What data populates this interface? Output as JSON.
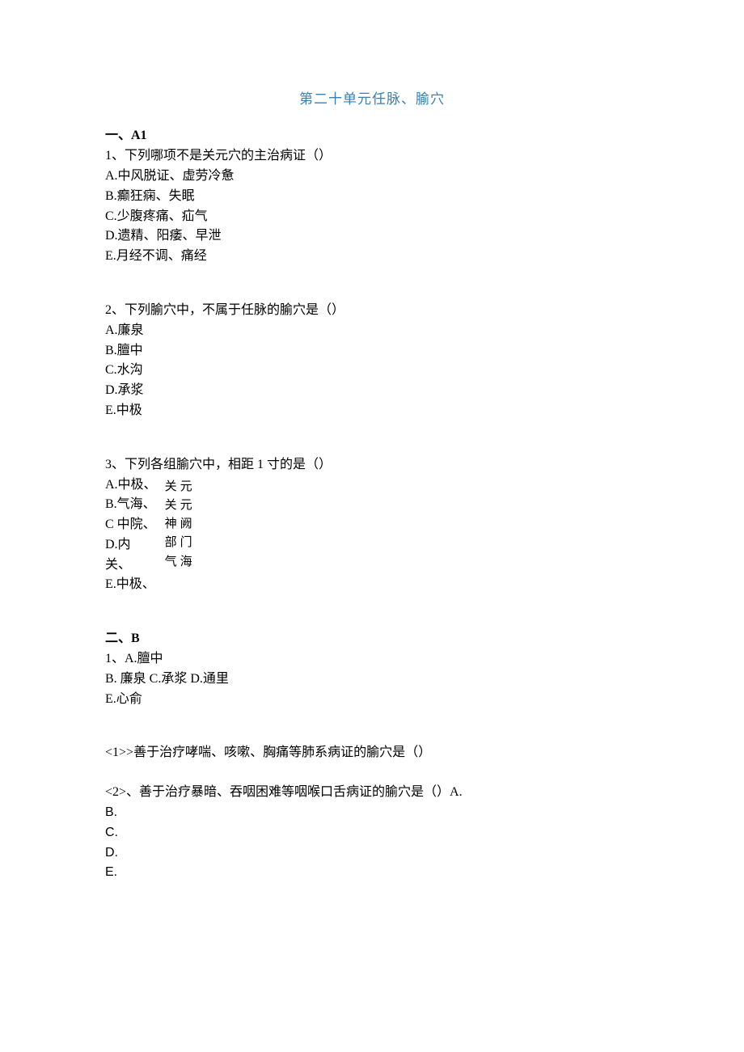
{
  "title": "第二十单元任脉、腧穴",
  "sectionA": {
    "heading": "一、A1",
    "q1": {
      "stem": "1、下列哪项不是关元穴的主治病证（）",
      "optA": "A.中风脱证、虚劳冷惫",
      "optB": "B.癫狂痫、失眠",
      "optC": "C.少腹疼痛、疝气",
      "optD": "D.遗精、阳痿、早泄",
      "optE": "E.月经不调、痛经"
    },
    "q2": {
      "stem": "2、下列腧穴中，不属于任脉的腧穴是（）",
      "optA": "A.廉泉",
      "optB": "B.膻中",
      "optC": "C.水沟",
      "optD": "D.承浆",
      "optE": "E.中极"
    },
    "q3": {
      "stem": "3、下列各组腧穴中，相距 1 寸的是（）",
      "leftA": "A.中极、",
      "leftB": "B.气海、",
      "leftC": "C 中院、",
      "leftD": "D.内",
      "leftD2": "关、",
      "leftE": "E.中极、",
      "r1": "关元",
      "r2": "关元",
      "r3": "神阙",
      "r4": "部门",
      "r5": "气海"
    }
  },
  "sectionB": {
    "heading": "二、B",
    "q1": {
      "stem": "1、A.膻中",
      "line2": "B. 廉泉 C.承浆 D.通里",
      "line3": "E.心俞",
      "sub1": "<1>>善于治疗哮喘、咳嗽、胸痛等肺系病证的腧穴是（）",
      "sub2": "<2>、善于治疗暴暗、吞咽困难等咽喉口舌病证的腧穴是（）A.",
      "bLabel": "B.",
      "cLabel": "C.",
      "dLabel": "D.",
      "eLabel": "E."
    }
  }
}
